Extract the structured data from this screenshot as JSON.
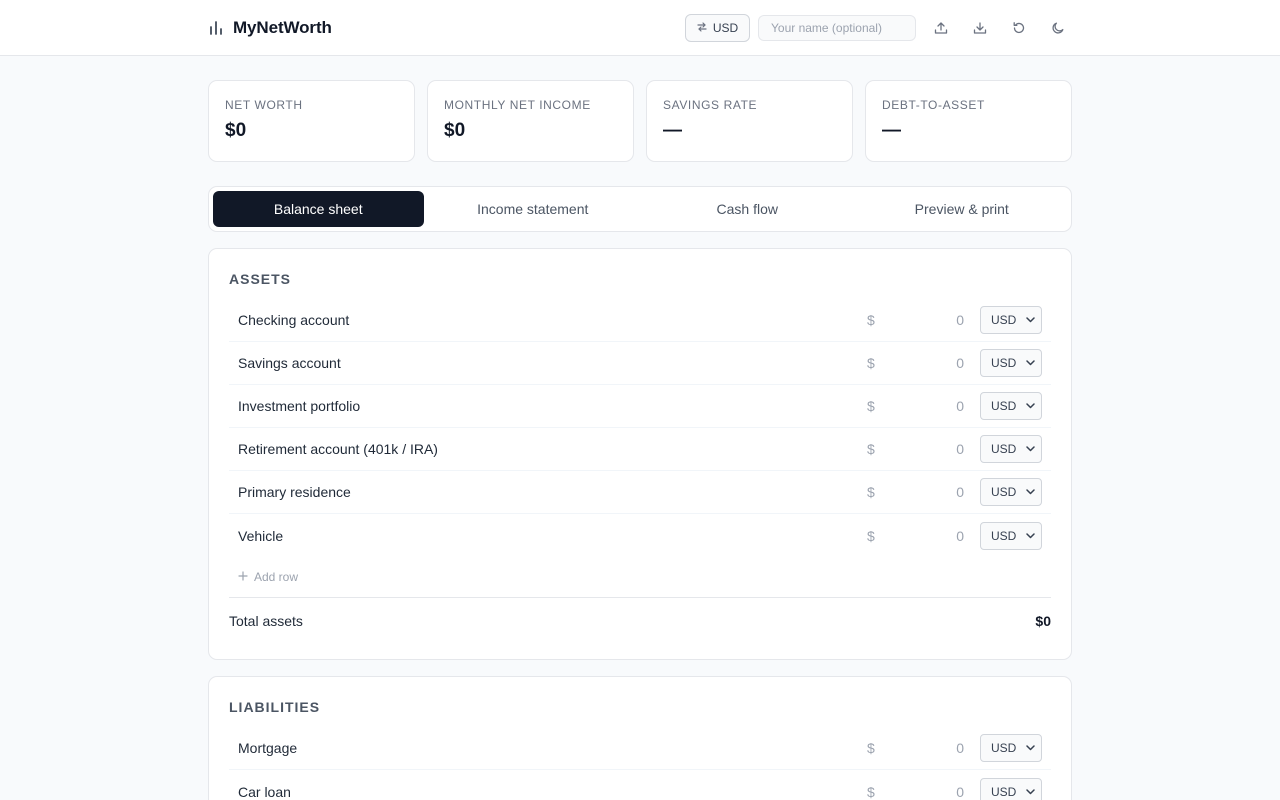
{
  "header": {
    "brand": "MyNetWorth",
    "currency_button": "USD",
    "name_placeholder": "Your name (optional)",
    "icons": [
      "bar-chart-icon",
      "swap-icon",
      "upload-icon",
      "download-icon",
      "reset-icon",
      "moon-icon"
    ]
  },
  "stats": [
    {
      "label": "Net worth",
      "value": "$0"
    },
    {
      "label": "Monthly net income",
      "value": "$0"
    },
    {
      "label": "Savings rate",
      "value": "—"
    },
    {
      "label": "Debt-to-asset",
      "value": "—"
    }
  ],
  "tabs": [
    {
      "label": "Balance sheet",
      "active": true
    },
    {
      "label": "Income statement",
      "active": false
    },
    {
      "label": "Cash flow",
      "active": false
    },
    {
      "label": "Preview & print",
      "active": false
    }
  ],
  "assets": {
    "title": "Assets",
    "rows": [
      {
        "label": "Checking account",
        "symbol": "$",
        "amount": "0",
        "currency": "USD"
      },
      {
        "label": "Savings account",
        "symbol": "$",
        "amount": "0",
        "currency": "USD"
      },
      {
        "label": "Investment portfolio",
        "symbol": "$",
        "amount": "0",
        "currency": "USD"
      },
      {
        "label": "Retirement account (401k / IRA)",
        "symbol": "$",
        "amount": "0",
        "currency": "USD"
      },
      {
        "label": "Primary residence",
        "symbol": "$",
        "amount": "0",
        "currency": "USD"
      },
      {
        "label": "Vehicle",
        "symbol": "$",
        "amount": "0",
        "currency": "USD"
      }
    ],
    "add_row": "Add row",
    "total_label": "Total assets",
    "total_value": "$0"
  },
  "liabilities": {
    "title": "Liabilities",
    "rows": [
      {
        "label": "Mortgage",
        "symbol": "$",
        "amount": "0",
        "currency": "USD"
      },
      {
        "label": "Car loan",
        "symbol": "$",
        "amount": "0",
        "currency": "USD"
      }
    ]
  },
  "colors": {
    "background": "#f8fafc",
    "active_tab": "#111827",
    "border": "#e5e7eb",
    "muted_text": "#9ca3af"
  }
}
